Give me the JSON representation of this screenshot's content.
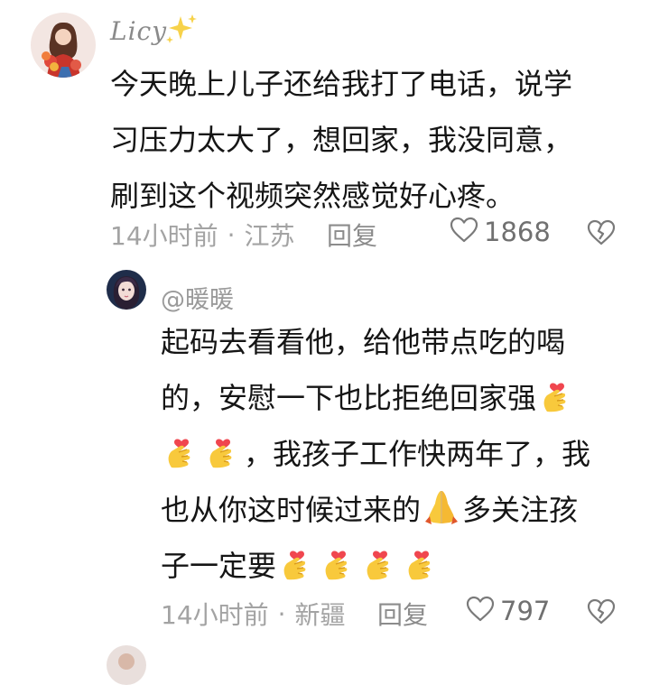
{
  "comment1": {
    "username": "Licy",
    "lines": [
      "今天晚上儿子还给我打了电话，说学",
      "习压力太大了，想回家，我没同意，",
      "刷到这个视频突然感觉好心疼。"
    ],
    "time": "14小时前",
    "location": "江苏",
    "reply_label": "回复",
    "like_count": "1868"
  },
  "comment2": {
    "username": "@暖暖",
    "line1": "起码去看看他，给他带点吃的喝",
    "line2": "的，安慰一下也比拒绝回家强",
    "line3": "，我孩子工作快两年了，我",
    "line4a": "也从你这时候过来的",
    "line4b": "多关注孩",
    "line5": "子一定要",
    "time": "14小时前",
    "location": "新疆",
    "reply_label": "回复",
    "like_count": "797"
  },
  "meta_separator": "·",
  "icons": [
    "sparkle-icon",
    "heart-icon",
    "broken-heart-icon",
    "finger-heart-emoji",
    "folded-hands-emoji"
  ]
}
